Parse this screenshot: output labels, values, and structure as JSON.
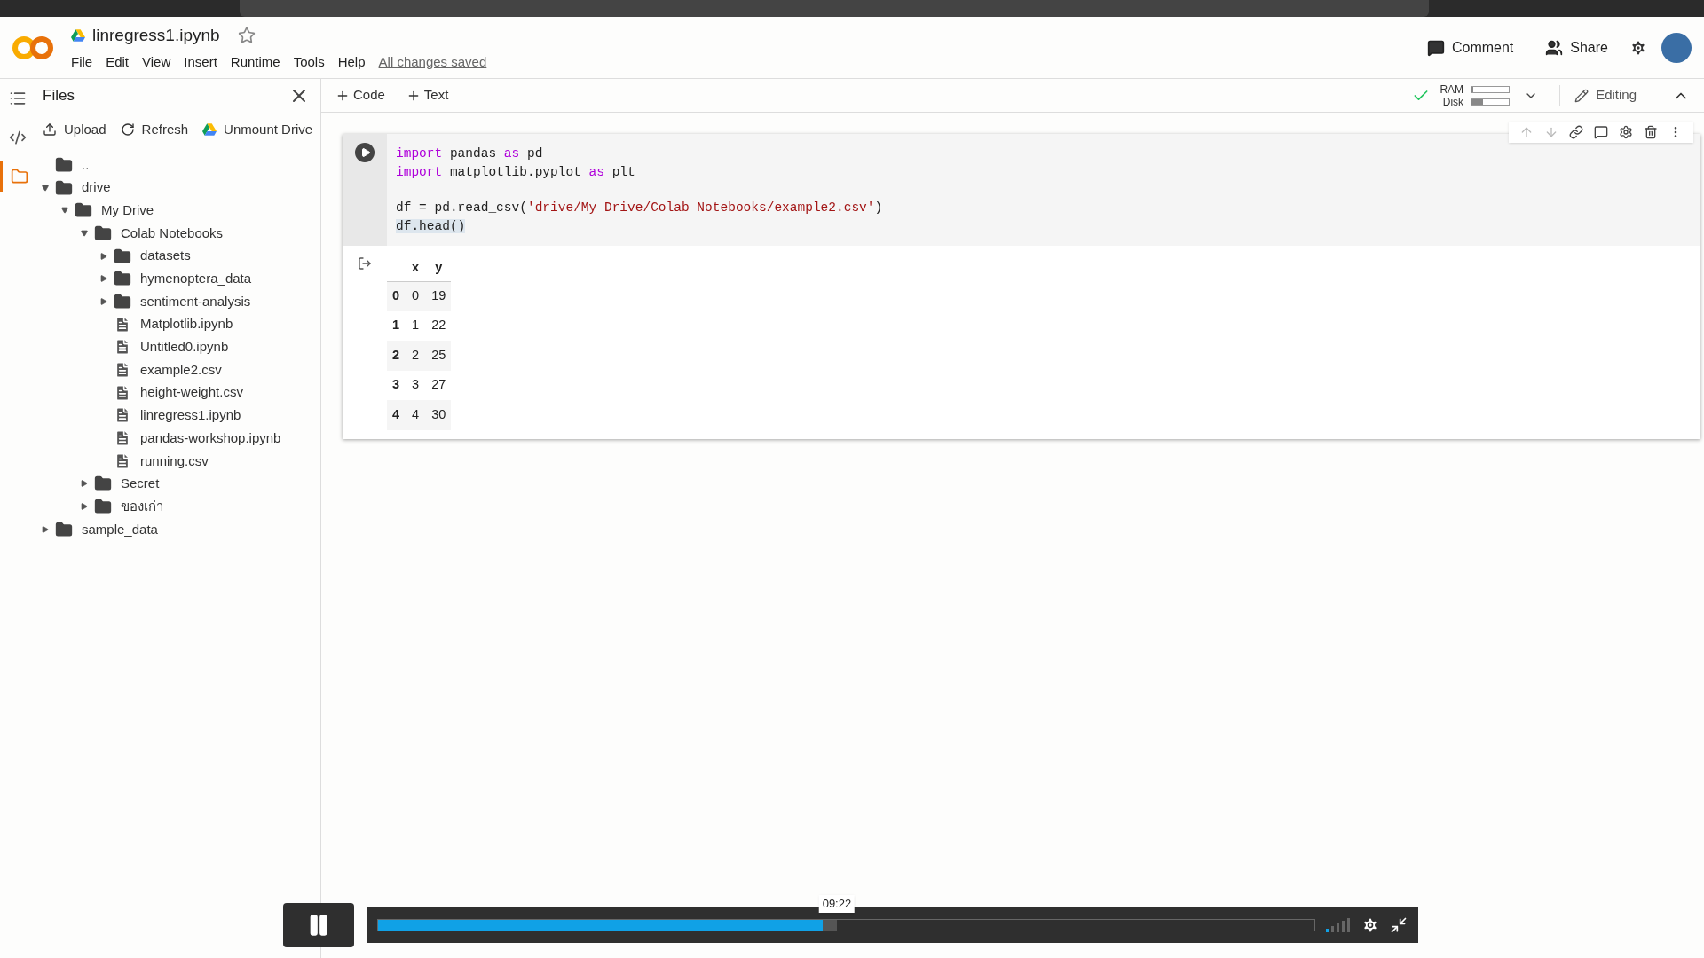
{
  "header": {
    "title": "linregress1.ipynb",
    "starred": false,
    "menu": [
      "File",
      "Edit",
      "View",
      "Insert",
      "Runtime",
      "Tools",
      "Help"
    ],
    "save_status": "All changes saved",
    "actions": [
      {
        "kind": "comment",
        "label": "Comment"
      },
      {
        "kind": "share",
        "label": "Share"
      }
    ]
  },
  "toolbar": {
    "insert": [
      "Code",
      "Text"
    ],
    "connected": true,
    "meters": [
      {
        "label": "RAM",
        "level": 0.05
      },
      {
        "label": "Disk",
        "level": 0.3
      }
    ],
    "mode": "Editing"
  },
  "sidebar": {
    "title": "Files",
    "actions": [
      {
        "kind": "upload",
        "label": "Upload"
      },
      {
        "kind": "refresh",
        "label": "Refresh"
      },
      {
        "kind": "drive",
        "label": "Unmount Drive"
      }
    ],
    "tree": [
      {
        "kind": "up",
        "name": ".."
      },
      {
        "kind": "folder",
        "name": "drive",
        "expanded": true,
        "children": [
          {
            "kind": "folder",
            "name": "My Drive",
            "expanded": true,
            "children": [
              {
                "kind": "folder",
                "name": "Colab Notebooks",
                "expanded": true,
                "children": [
                  {
                    "kind": "folder",
                    "name": "datasets",
                    "expanded": false
                  },
                  {
                    "kind": "folder",
                    "name": "hymenoptera_data",
                    "expanded": false
                  },
                  {
                    "kind": "folder",
                    "name": "sentiment-analysis",
                    "expanded": false
                  },
                  {
                    "kind": "file",
                    "name": "Matplotlib.ipynb"
                  },
                  {
                    "kind": "file",
                    "name": "Untitled0.ipynb"
                  },
                  {
                    "kind": "file",
                    "name": "example2.csv"
                  },
                  {
                    "kind": "file",
                    "name": "height-weight.csv"
                  },
                  {
                    "kind": "file",
                    "name": "linregress1.ipynb"
                  },
                  {
                    "kind": "file",
                    "name": "pandas-workshop.ipynb"
                  },
                  {
                    "kind": "file",
                    "name": "running.csv"
                  }
                ]
              },
              {
                "kind": "folder",
                "name": "Secret",
                "expanded": false
              },
              {
                "kind": "folder",
                "name": "ของเก่า",
                "expanded": false
              }
            ]
          }
        ]
      },
      {
        "kind": "folder",
        "name": "sample_data",
        "expanded": false
      }
    ]
  },
  "cell": {
    "code_blocks": [
      [
        [
          {
            "kind": "kw",
            "text": "import"
          },
          {
            "kind": "plain",
            "text": " pandas "
          },
          {
            "kind": "kw",
            "text": "as"
          },
          {
            "kind": "plain",
            "text": " pd"
          }
        ],
        [
          {
            "kind": "kw",
            "text": "import"
          },
          {
            "kind": "plain",
            "text": " matplotlib.pyplot "
          },
          {
            "kind": "kw",
            "text": "as"
          },
          {
            "kind": "plain",
            "text": " plt"
          }
        ]
      ],
      [
        [
          {
            "kind": "plain",
            "text": "df = pd.read_csv("
          },
          {
            "kind": "str",
            "text": "'drive/My Drive/Colab Notebooks/example2.csv'"
          },
          {
            "kind": "plain",
            "text": ")"
          }
        ],
        [
          {
            "kind": "sel",
            "text": "df.head()"
          }
        ]
      ]
    ],
    "output": {
      "columns": [
        "",
        "x",
        "y"
      ],
      "rows": [
        [
          "0",
          "0",
          "19"
        ],
        [
          "1",
          "1",
          "22"
        ],
        [
          "2",
          "2",
          "25"
        ],
        [
          "3",
          "3",
          "27"
        ],
        [
          "4",
          "4",
          "30"
        ]
      ]
    }
  },
  "player": {
    "playing": true,
    "time": "09:22",
    "level": 0.49
  }
}
